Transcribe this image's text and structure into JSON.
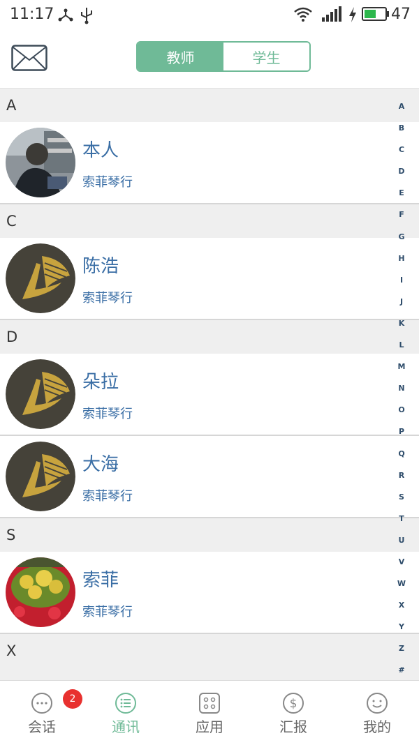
{
  "status": {
    "time": "11:17",
    "battery": "47"
  },
  "header": {
    "tabs": [
      "教师",
      "学生"
    ]
  },
  "sections": [
    {
      "letter": "A",
      "contacts": [
        {
          "name": "本人",
          "org": "索菲琴行",
          "avatar": "photo-person"
        }
      ]
    },
    {
      "letter": "C",
      "contacts": [
        {
          "name": "陈浩",
          "org": "索菲琴行",
          "avatar": "logo-L"
        }
      ]
    },
    {
      "letter": "D",
      "contacts": [
        {
          "name": "朵拉",
          "org": "索菲琴行",
          "avatar": "logo-L"
        },
        {
          "name": "大海",
          "org": "索菲琴行",
          "avatar": "logo-L"
        }
      ]
    },
    {
      "letter": "S",
      "contacts": [
        {
          "name": "索菲",
          "org": "索菲琴行",
          "avatar": "photo-flowers"
        }
      ]
    },
    {
      "letter": "X",
      "contacts": []
    }
  ],
  "index": [
    "A",
    "B",
    "C",
    "D",
    "E",
    "F",
    "G",
    "H",
    "I",
    "J",
    "K",
    "L",
    "M",
    "N",
    "O",
    "P",
    "Q",
    "R",
    "S",
    "T",
    "U",
    "V",
    "W",
    "X",
    "Y",
    "Z",
    "#"
  ],
  "tabbar": [
    {
      "label": "会话",
      "icon": "chat-icon",
      "badge": "2"
    },
    {
      "label": "通讯",
      "icon": "contacts-icon",
      "active": true
    },
    {
      "label": "应用",
      "icon": "apps-icon"
    },
    {
      "label": "汇报",
      "icon": "dollar-icon"
    },
    {
      "label": "我的",
      "icon": "smiley-icon"
    }
  ],
  "colors": {
    "accent": "#6fba97",
    "name": "#3a6ea5",
    "badge": "#e8312f"
  }
}
